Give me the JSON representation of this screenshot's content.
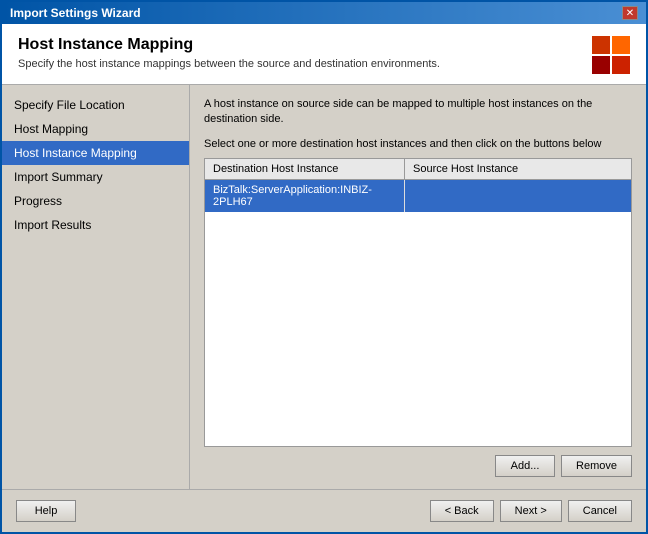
{
  "window": {
    "title": "Import Settings Wizard",
    "close_label": "✕"
  },
  "header": {
    "title": "Host Instance Mapping",
    "description": "Specify the host instance mappings between the source and destination environments."
  },
  "sidebar": {
    "items": [
      {
        "label": "Specify File Location",
        "active": false
      },
      {
        "label": "Host Mapping",
        "active": false
      },
      {
        "label": "Host Instance Mapping",
        "active": true
      },
      {
        "label": "Import Summary",
        "active": false
      },
      {
        "label": "Progress",
        "active": false
      },
      {
        "label": "Import Results",
        "active": false
      }
    ]
  },
  "main": {
    "description_line1": "A host instance on source side can be mapped to multiple host instances on the destination side.",
    "description_line2": "Select one or more destination host instances and then click on the buttons below",
    "table": {
      "columns": [
        {
          "label": "Destination Host Instance"
        },
        {
          "label": "Source Host Instance"
        }
      ],
      "rows": [
        {
          "destination": "BizTalk:ServerApplication:INBIZ-2PLH67",
          "source": "",
          "selected": true
        }
      ]
    },
    "buttons": {
      "add_label": "Add...",
      "remove_label": "Remove"
    }
  },
  "footer": {
    "help_label": "Help",
    "back_label": "< Back",
    "next_label": "Next >",
    "cancel_label": "Cancel"
  }
}
